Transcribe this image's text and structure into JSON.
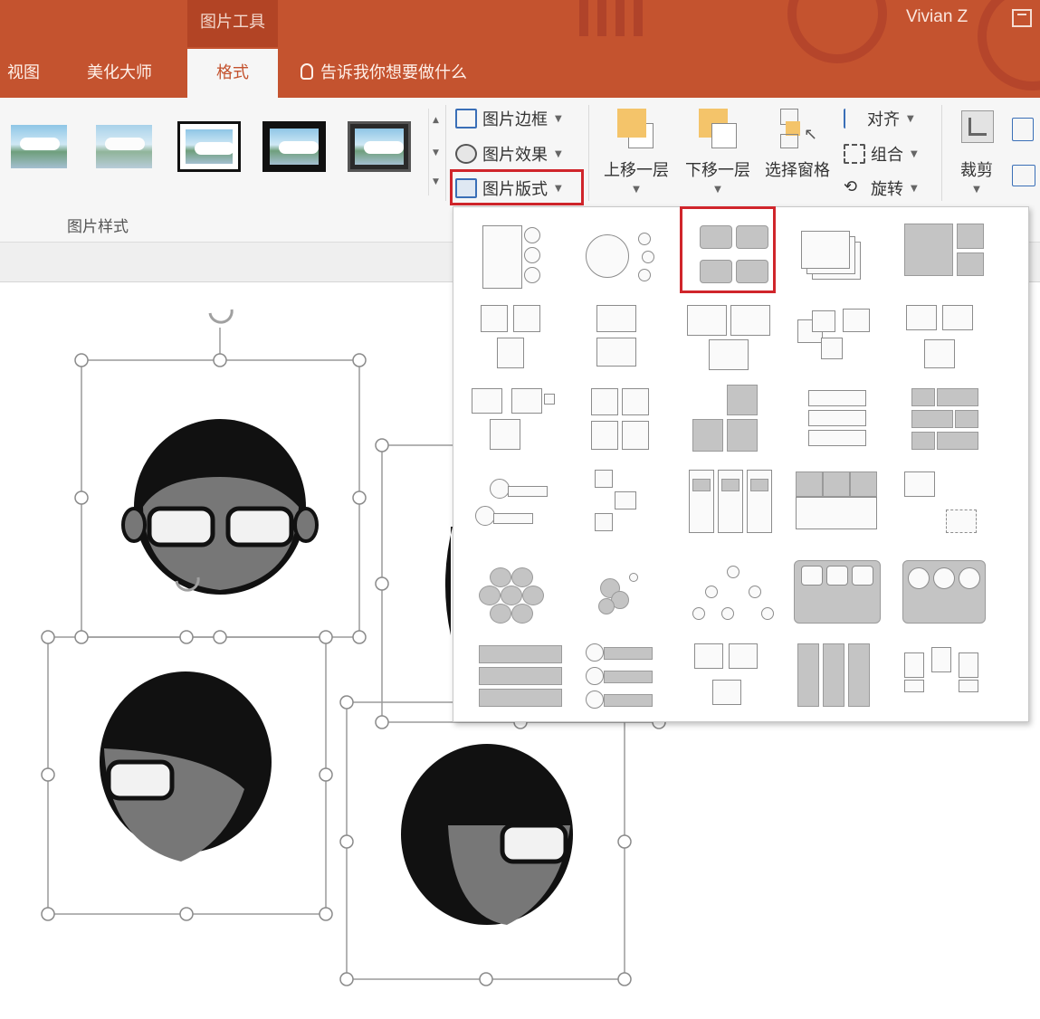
{
  "window": {
    "context_title": "图片工具",
    "user": "Vivian Z"
  },
  "tabs": [
    {
      "label": "视图"
    },
    {
      "label": "美化大师"
    },
    {
      "label": "格式",
      "active": true
    }
  ],
  "tell_me": "告诉我你想要做什么",
  "ribbon": {
    "picture_styles_label": "图片样式",
    "picture_border": "图片边框",
    "picture_effects": "图片效果",
    "picture_layout": "图片版式",
    "bring_forward": "上移一层",
    "send_backward": "下移一层",
    "selection_pane": "选择窗格",
    "align": "对齐",
    "group": "组合",
    "rotate": "旋转",
    "crop": "裁剪"
  },
  "style_gallery": [
    "simple-frame",
    "soft-edge",
    "white-border",
    "black-border",
    "thick-frame"
  ],
  "layout_gallery": {
    "rows": 6,
    "columns": 5,
    "selected_index": 2
  },
  "colors": {
    "accent": "#c4532f",
    "highlight": "#d0252b",
    "ribbon_bg": "#f6f6f6"
  },
  "icons": {
    "bulb": "lightbulb-icon",
    "border": "picture-border-icon",
    "effects": "picture-effects-icon",
    "layout": "picture-layout-icon",
    "rotate": "rotate-handle-icon"
  }
}
